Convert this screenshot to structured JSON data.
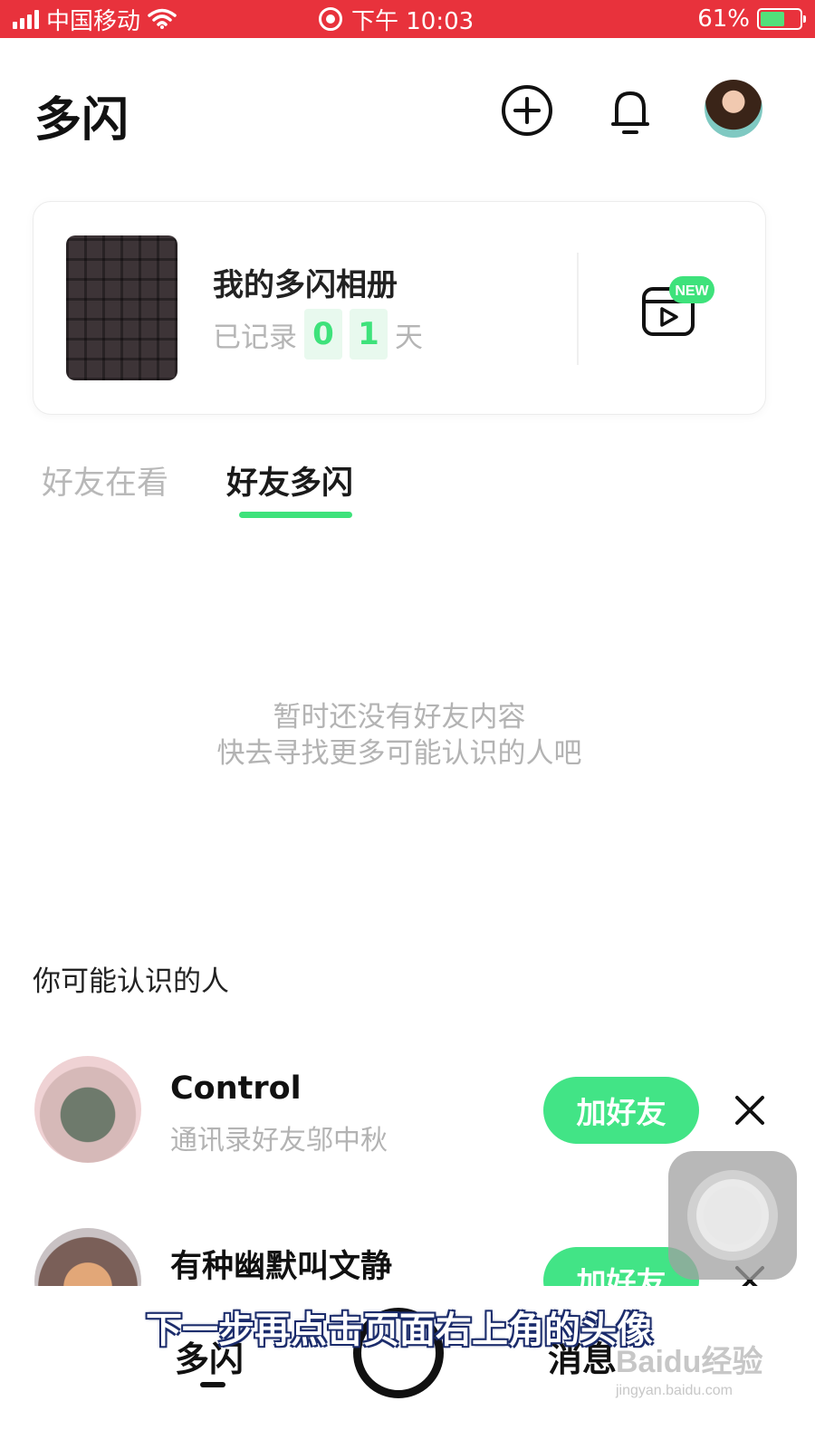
{
  "status_bar": {
    "carrier": "中国移动",
    "time": "下午 10:03",
    "battery_percent": "61%",
    "battery_level": 0.61,
    "icons": [
      "signal-icon",
      "wifi-icon",
      "screen-record-icon",
      "battery-icon"
    ]
  },
  "header": {
    "title": "多闪",
    "icons": [
      "plus-circle-icon",
      "bell-icon",
      "avatar"
    ]
  },
  "album": {
    "title": "我的多闪相册",
    "recorded_prefix": "已记录",
    "digits": [
      "0",
      "1"
    ],
    "recorded_suffix": "天",
    "new_badge": "NEW",
    "icon": "video-album-icon"
  },
  "tabs": [
    {
      "label": "好友在看",
      "active": false
    },
    {
      "label": "好友多闪",
      "active": true
    }
  ],
  "empty_state": {
    "line1": "暂时还没有好友内容",
    "line2": "快去寻找更多可能认识的人吧"
  },
  "suggestions": {
    "title": "你可能认识的人",
    "people": [
      {
        "name": "Control",
        "subtitle": "通讯录好友邬中秋",
        "button": "加好友"
      },
      {
        "name": "有种幽默叫文静",
        "subtitle": "",
        "button": "加好友"
      }
    ]
  },
  "bottom_nav": {
    "home": "多闪",
    "messages": "消息",
    "center_icon": "camera-shutter-icon"
  },
  "caption": "下一步再点击页面右上角的头像",
  "watermark": {
    "logo": "Baidu经验",
    "url": "jingyan.baidu.com"
  },
  "colors": {
    "status_bar": "#e8323c",
    "accent_green": "#42e486",
    "text_gray": "#b3b3b3"
  }
}
